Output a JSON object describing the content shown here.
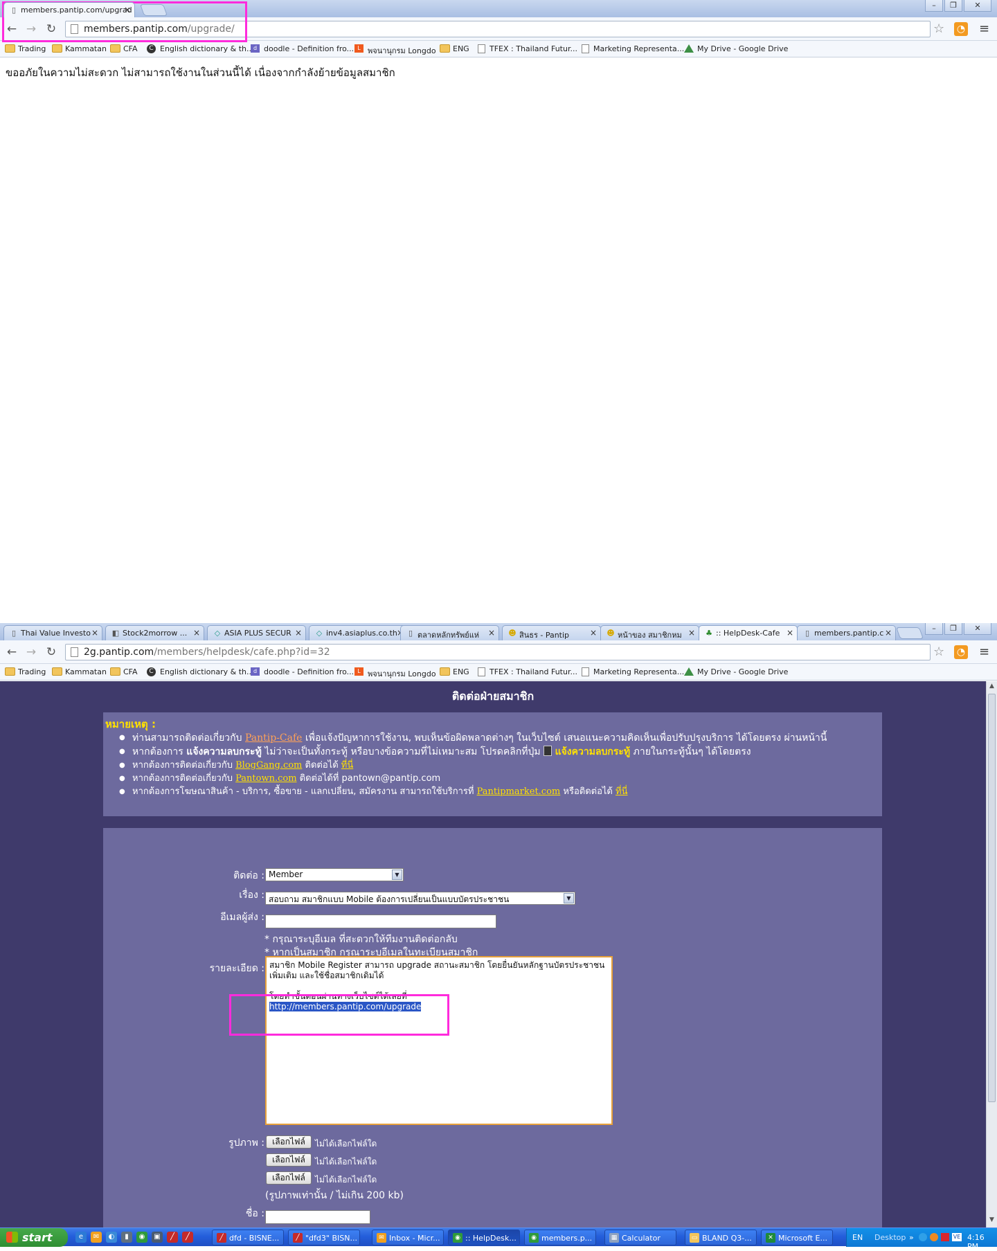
{
  "window1": {
    "tab": {
      "title": "members.pantip.com/upgrad",
      "close": "×"
    },
    "address": {
      "host": "members.pantip.com",
      "path": "/upgrade/"
    },
    "notice": "ขออภัยในความไม่สะดวก ไม่สามารถใช้งานในส่วนนี้ได้ เนื่องจากกำลังย้ายข้อมูลสมาชิก"
  },
  "bookmarks": [
    "Trading",
    "Kammatan",
    "CFA",
    "English dictionary & th...",
    "doodle - Definition fro...",
    "พจนานุกรม Longdo",
    "ENG",
    "TFEX : Thailand Futur...",
    "Marketing Representa...",
    "My Drive - Google Drive"
  ],
  "window2": {
    "tabs": [
      "Thai Value Investo",
      "Stock2morrow ...",
      "ASIA PLUS SECUR",
      "inv4.asiaplus.co.th",
      "ตลาดหลักทรัพย์แห่",
      "สินธร - Pantip",
      "หน้าของ สมาชิกหม",
      ":: HelpDesk-Cafe",
      "members.pantip.c"
    ],
    "address": {
      "host": "2g.pantip.com",
      "path": "/members/helpdesk/cafe.php?id=32"
    },
    "page_title": "ติดต่อฝ่ายสมาชิก",
    "remark": {
      "heading": "หมายเหตุ :",
      "items": [
        {
          "before": "ท่านสามารถติดต่อเกี่ยวกับ",
          "link": "Pantip-Cafe",
          "after": "เพื่อแจ้งปัญหาการใช้งาน, พบเห็นข้อผิดพลาดต่างๆ ในเว็บไซต์ เสนอแนะความคิดเห็นเพื่อปรับปรุงบริการ ได้โดยตรง ผ่านหน้านี้"
        },
        {
          "before": "หากต้องการ",
          "bold": "แจ้งความลบกระทู้",
          "after": "ไม่ว่าจะเป็นทั้งกระทู้ หรือบางข้อความที่ไม่เหมาะสม โปรดคลิกที่ปุ่ม",
          "bold2": "แจ้งความลบกระทู้",
          "after2": "ภายในกระทู้นั้นๆ ได้โดยตรง"
        },
        {
          "before": "หากต้องการติดต่อเกี่ยวกับ",
          "link": "BlogGang.com",
          "after": "ติดต่อได้",
          "link2": "ที่นี่"
        },
        {
          "before": "หากต้องการติดต่อเกี่ยวกับ",
          "link": "Pantown.com",
          "after": "ติดต่อได้ที่ pantown@pantip.com"
        },
        {
          "before": "หากต้องการโฆษณาสินค้า - บริการ, ซื้อขาย - แลกเปลี่ยน, สมัครงาน สามารถใช้บริการที่",
          "link": "Pantipmarket.com",
          "after": "หรือติดต่อได้",
          "link2": "ที่นี่"
        }
      ]
    },
    "form": {
      "contact_label": "ติดต่อ :",
      "contact_value": "Member",
      "subject_label": "เรื่อง :",
      "subject_value": "สอบถาม สมาชิกแบบ Mobile ต้องการเปลี่ยนเป็นแบบบัตรประชาชน",
      "email_label": "อีเมลผู้ส่ง :",
      "email_value": "",
      "email_hint1": "* กรุณาระบุอีเมล ที่สะดวกให้ทีมงานติดต่อกลับ",
      "email_hint2": "* หากเป็นสมาชิก กรุณาระบุอีเมลในทะเบียนสมาชิก",
      "detail_label": "รายละเอียด :",
      "detail_line1": "สมาชิก Mobile Register สามารถ upgrade สถานะสมาชิก โดยยื่นยันหลักฐานบัตรประชาชน",
      "detail_line2": "เพิ่มเติม และใช้ชื่อสมาชิกเดิมได้",
      "detail_line3": "โดยทำขั้นตอนผ่านทางเว็บไซต์ได้เลยที่",
      "detail_link": "http://members.pantip.com/upgrade",
      "image_label": "รูปภาพ :",
      "file_button": "เลือกไฟล์",
      "file_status": "ไม่ได้เลือกไฟล์ใด",
      "image_hint": "(รูปภาพเท่านั้น / ไม่เกิน 200 kb)",
      "name_label": "ชื่อ :"
    }
  },
  "taskbar": {
    "start": "start",
    "items": [
      "dfd - BISNE...",
      "\"dfd3\" BISN...",
      "Inbox - Micr...",
      ":: HelpDesk...",
      "members.p...",
      "Calculator",
      "BLAND Q3-...",
      "Microsoft E..."
    ],
    "lang": "EN",
    "desktop": "Desktop",
    "clock": "4:16 PM"
  },
  "colors": {
    "highlight": "#ff2bdc",
    "page_bg": "#3f3a6b",
    "panel_bg": "#6d6a9e",
    "link_yellow": "#ffe000"
  }
}
